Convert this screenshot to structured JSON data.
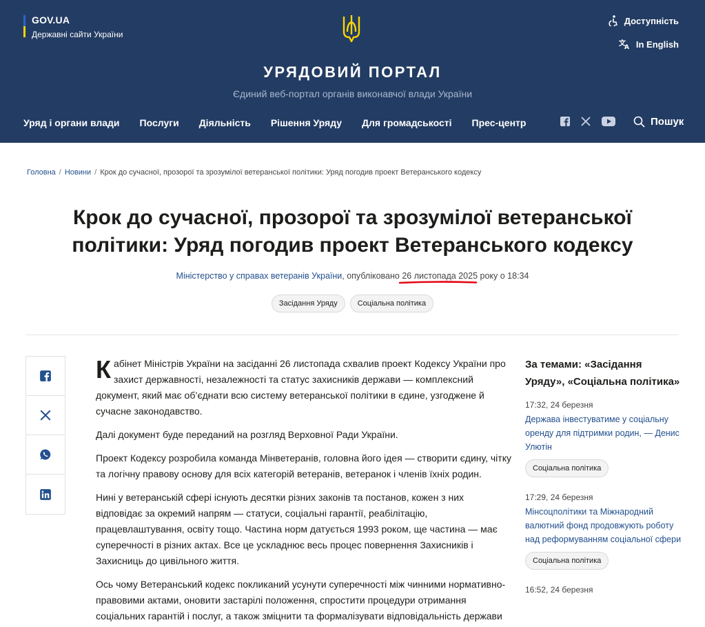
{
  "header": {
    "gov_title": "GOV.UA",
    "gov_subtitle": "Державні сайти України",
    "accessibility_label": "Доступність",
    "language_label": "In English",
    "portal_title": "УРЯДОВИЙ ПОРТАЛ",
    "portal_subtitle": "Єдиний веб-портал органів виконавчої влади України",
    "search_label": "Пошук",
    "nav": [
      {
        "label": "Уряд і органи влади"
      },
      {
        "label": "Послуги"
      },
      {
        "label": "Діяльність"
      },
      {
        "label": "Рішення Уряду"
      },
      {
        "label": "Для громадськості"
      },
      {
        "label": "Прес-центр"
      }
    ]
  },
  "breadcrumb": {
    "home": "Головна",
    "news": "Новини",
    "current": "Крок до сучасної, прозорої та зрозумілої ветеранської політики: Уряд погодив проект Ветеранського кодексу"
  },
  "article": {
    "title": "Крок до сучасної, прозорої та зрозумілої ветеранської політики: Уряд погодив проект Ветеранського кодексу",
    "author": "Міністерство у справах ветеранів України",
    "published_prefix": ", опубліковано ",
    "date": "26 листопада 2025",
    "time_suffix": " року о 18:34",
    "tags": [
      "Засідання Уряду",
      "Соціальна політика"
    ],
    "dropcap": "К",
    "p1_rest": "абінет Міністрів України на засіданні 26 листопада схвалив проект Кодексу України про захист державності, незалежності та статус захисників держави — комплексний документ, який має об’єднати всю систему ветеранської політики в єдине, узгоджене й сучасне законодавство.",
    "p2": "Далі документ буде переданий на розгляд Верховної Ради України.",
    "p3": "Проект Кодексу розробила команда Мінветеранів, головна його ідея — створити єдину, чітку та логічну правову основу для всіх категорій ветеранів, ветеранок і членів їхніх родин.",
    "p4": "Нині у ветеранській сфері існують десятки різних законів та постанов, кожен з них відповідає за окремий напрям — статуси, соціальні гарантії, реабілітацію, працевлаштування, освіту тощо. Частина норм датується 1993 роком, ще частина — має суперечності в різних актах. Все це ускладнює весь процес повернення Захисників і Захисниць до цивільного життя.",
    "p5": "Ось чому Ветеранський кодекс покликаний усунути суперечності між чинними нормативно-правовими актами, оновити застарілі положення, спростити процедури отримання соціальних гарантій і послуг, а також зміцнити та формалізувати відповідальність держави перед своїми Захисниками і Захисницями."
  },
  "sidebar": {
    "heading": "За темами: «Засідання Уряду», «Соціальна політика»",
    "items": [
      {
        "time": "17:32, 24 березня",
        "title": "Держава інвестуватиме у соціальну оренду для підтримки родин, — Денис Улютін",
        "tag": "Соціальна політика"
      },
      {
        "time": "17:29, 24 березня",
        "title": "Мінсоцполітики та Міжнародний валютний фонд продовжують роботу над реформуванням соціальної сфери",
        "tag": "Соціальна політика"
      },
      {
        "time": "16:52, 24 березня",
        "title": "",
        "tag": ""
      }
    ]
  },
  "colors": {
    "header_bg": "#233c63",
    "link": "#23508e",
    "accent_yellow": "#ffd500",
    "highlight_red": "#e30613"
  }
}
